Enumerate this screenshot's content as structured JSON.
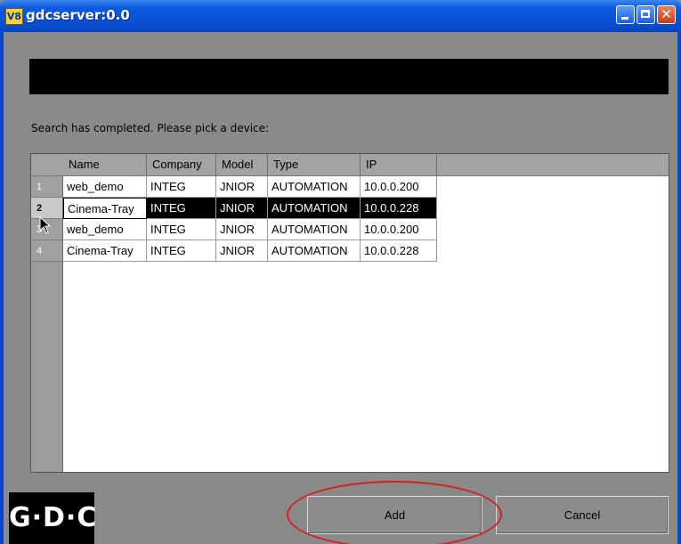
{
  "window": {
    "app_icon": "V8",
    "title": "gdcserver:0.0",
    "close_glyph": "✕"
  },
  "status_text": "Search has completed. Please pick a device:",
  "table": {
    "columns": [
      "Name",
      "Company",
      "Model",
      "Type",
      "IP"
    ],
    "rows": [
      {
        "num": "1",
        "cells": [
          "web_demo",
          "INTEG",
          "JNIOR",
          "AUTOMATION",
          "10.0.0.200"
        ]
      },
      {
        "num": "2",
        "cells": [
          "Cinema-Tray",
          "INTEG",
          "JNIOR",
          "AUTOMATION",
          "10.0.0.228"
        ]
      },
      {
        "num": "3",
        "cells": [
          "web_demo",
          "INTEG",
          "JNIOR",
          "AUTOMATION",
          "10.0.0.200"
        ]
      },
      {
        "num": "4",
        "cells": [
          "Cinema-Tray",
          "INTEG",
          "JNIOR",
          "AUTOMATION",
          "10.0.0.228"
        ]
      }
    ],
    "selected_row": 2
  },
  "logo": {
    "text": "G·D·C"
  },
  "buttons": {
    "add": "Add",
    "cancel": "Cancel"
  },
  "colors": {
    "selection": "#000000",
    "annotation_ring": "#d42020",
    "titlebar": "#0a4fd2"
  }
}
